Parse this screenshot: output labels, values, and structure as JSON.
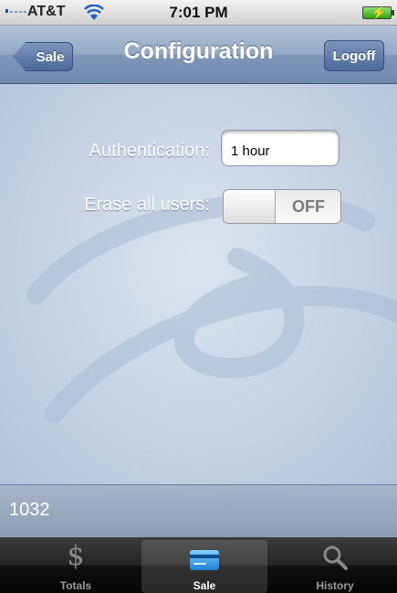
{
  "status_bar": {
    "carrier": "AT&T",
    "time": "7:01 PM",
    "wifi_icon": "wifi-icon",
    "battery_icon": "battery-charging-icon"
  },
  "nav": {
    "back_label": "Sale",
    "title": "Configuration",
    "right_label": "Logoff"
  },
  "form": {
    "authentication_label": "Authentication:",
    "authentication_value": "1 hour",
    "erase_label": "Erase all users:",
    "erase_state": "OFF"
  },
  "info_bar": {
    "code": "1032"
  },
  "tabs": [
    {
      "label": "Totals",
      "icon": "dollar-icon",
      "selected": false
    },
    {
      "label": "Sale",
      "icon": "credit-card-icon",
      "selected": true
    },
    {
      "label": "History",
      "icon": "search-icon",
      "selected": false
    }
  ],
  "colors": {
    "nav_bar": "#8aa0bf",
    "content_bg": "#c6d3e4",
    "tab_bar": "#111111"
  }
}
